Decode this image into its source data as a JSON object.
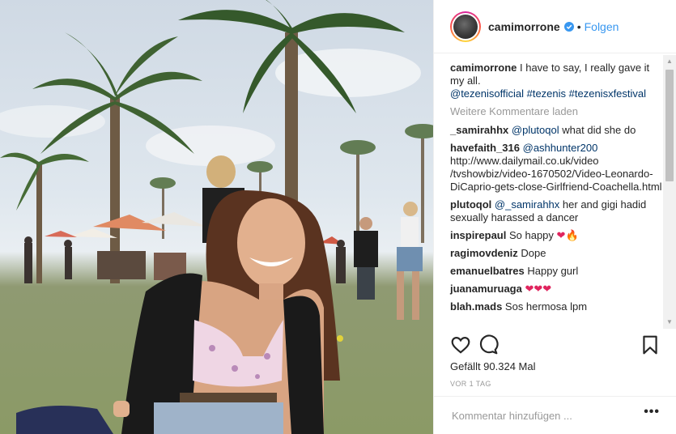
{
  "header": {
    "username": "camimorrone",
    "separator": "•",
    "follow_label": "Folgen",
    "colors": {
      "link": "#3897f0",
      "verified": "#3897f0"
    }
  },
  "caption": {
    "user": "camimorrone",
    "text": "I have to say, I really gave it my all.",
    "tags": "@tezenisofficial #tezenis #tezenisxfestival"
  },
  "load_more_label": "Weitere Kommentare laden",
  "comments": [
    {
      "user": "_samirahhx",
      "mention": "@plutoqol",
      "text": "what did she do"
    },
    {
      "user": "havefaith_316",
      "mention": "@ashhunter200",
      "text": "http://www.dailymail.co.uk/video /tvshowbiz/video-1670502/Video-Leonardo-DiCaprio-gets-close-Girlfriend-Coachella.html"
    },
    {
      "user": "plutoqol",
      "mention": "@_samirahhx",
      "text": "her and gigi hadid sexually harassed a dancer"
    },
    {
      "user": "inspirepaul",
      "text": "So happy",
      "emoji": "❤🔥"
    },
    {
      "user": "ragimovdeniz",
      "text": "Dope"
    },
    {
      "user": "emanuelbatres",
      "text": "Happy gurl"
    },
    {
      "user": "juanamuruaga",
      "emoji": "❤❤❤"
    },
    {
      "user": "blah.mads",
      "text": "Sos hermosa lpm"
    }
  ],
  "actions": {
    "like_icon": "heart-outline-icon",
    "comment_icon": "speech-bubble-icon",
    "save_icon": "bookmark-icon"
  },
  "likes_text": "Gefällt 90.324 Mal",
  "timestamp": "VOR 1 TAG",
  "add_comment": {
    "placeholder": "Kommentar hinzufügen ...",
    "more_label": "•••"
  },
  "scrollbar": {
    "up_icon": "▲",
    "down_icon": "▼"
  }
}
